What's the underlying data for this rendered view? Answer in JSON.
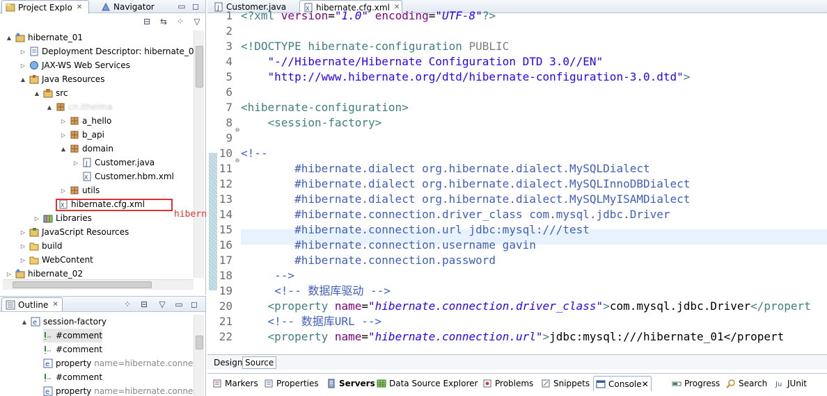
{
  "explorer": {
    "tabs": [
      {
        "label": "Project Explo",
        "icon": "project-explorer-icon"
      },
      {
        "label": "Navigator",
        "icon": "navigator-icon"
      }
    ],
    "items": [
      {
        "label": "hibernate_01",
        "icon": "project-icon",
        "twisty": "▲"
      },
      {
        "label": "Deployment Descriptor: hibernate_0",
        "icon": "descriptor-icon",
        "twisty": "▷"
      },
      {
        "label": "JAX-WS Web Services",
        "icon": "webservice-icon",
        "twisty": "▷"
      },
      {
        "label": "Java Resources",
        "icon": "java-resources-icon",
        "twisty": "▲"
      },
      {
        "label": "src",
        "icon": "source-folder-icon",
        "twisty": "▲"
      },
      {
        "label": "cn.itheima",
        "icon": "package-icon",
        "twisty": "▲"
      },
      {
        "label": "a_hello",
        "icon": "package-icon",
        "twisty": "▷"
      },
      {
        "label": "b_api",
        "icon": "package-icon",
        "twisty": "▷"
      },
      {
        "label": "domain",
        "icon": "package-icon",
        "twisty": "▲"
      },
      {
        "label": "Customer.java",
        "icon": "java-file-icon",
        "twisty": "▷"
      },
      {
        "label": "Customer.hbm.xml",
        "icon": "xml-file-icon",
        "twisty": ""
      },
      {
        "label": "utils",
        "icon": "package-icon",
        "twisty": "▷"
      },
      {
        "label": "hibernate.cfg.xml",
        "icon": "xml-file-icon",
        "twisty": ""
      },
      {
        "label": "Libraries",
        "icon": "libraries-icon",
        "twisty": "▷"
      },
      {
        "label": "JavaScript Resources",
        "icon": "js-resources-icon",
        "twisty": "▷"
      },
      {
        "label": "build",
        "icon": "folder-icon",
        "twisty": "▷"
      },
      {
        "label": "WebContent",
        "icon": "folder-icon",
        "twisty": "▷"
      },
      {
        "label": "hibernate_02",
        "icon": "project-icon",
        "twisty": "▷"
      }
    ]
  },
  "annotation": "hibernate在src根目录下",
  "outline": {
    "tab_label": "Outline",
    "items": [
      {
        "label": "session-factory",
        "attr": "",
        "icon": "element-icon"
      },
      {
        "label": "#comment",
        "attr": "",
        "icon": "comment-icon"
      },
      {
        "label": "#comment",
        "attr": "",
        "icon": "comment-icon"
      },
      {
        "label": "property",
        "attr": "name=hibernate.conne",
        "icon": "element-icon"
      },
      {
        "label": "#comment",
        "attr": "",
        "icon": "comment-icon"
      },
      {
        "label": "property",
        "attr": "name=hibernate.conne",
        "icon": "element-icon"
      }
    ]
  },
  "editor": {
    "tabs": [
      {
        "label": "Customer.java",
        "icon": "java-file-icon"
      },
      {
        "label": "hibernate.cfg.xml",
        "icon": "xml-file-icon"
      }
    ],
    "bottom_tabs": [
      "Design",
      "Source"
    ],
    "lines": [
      {
        "n": "1",
        "segs": [
          [
            "tagc",
            "<?xml "
          ],
          [
            "attr",
            "version"
          ],
          [
            "blk",
            "="
          ],
          [
            "val",
            "\"1.0\""
          ],
          [
            "blk",
            " "
          ],
          [
            "attr",
            "encoding"
          ],
          [
            "blk",
            "="
          ],
          [
            "val",
            "\"UTF-8\""
          ],
          [
            "tagc",
            "?>"
          ]
        ]
      },
      {
        "n": "2",
        "segs": []
      },
      {
        "n": "3",
        "segs": [
          [
            "tagc",
            "<!DOCTYPE "
          ],
          [
            "tagc",
            "hibernate-configuration "
          ],
          [
            "gray",
            "PUBLIC"
          ]
        ]
      },
      {
        "n": "4",
        "segs": [
          [
            "str",
            "    \"-//Hibernate/Hibernate Configuration DTD 3.0//EN\""
          ]
        ]
      },
      {
        "n": "5",
        "segs": [
          [
            "str",
            "    \"http://www.hibernate.org/dtd/hibernate-configuration-3.0.dtd\""
          ],
          [
            "tagc",
            ">"
          ]
        ]
      },
      {
        "n": "6",
        "segs": []
      },
      {
        "n": "7",
        "segs": [
          [
            "tagc",
            "<hibernate-configuration>"
          ]
        ]
      },
      {
        "n": "8",
        "segs": [
          [
            "tagc",
            "    <session-factory>"
          ]
        ]
      },
      {
        "n": "9",
        "segs": []
      },
      {
        "n": "10",
        "segs": [
          [
            "cmt",
            "<!--"
          ]
        ]
      },
      {
        "n": "11",
        "segs": [
          [
            "cmt",
            "        #hibernate.dialect org.hibernate.dialect.MySQLDialect"
          ]
        ]
      },
      {
        "n": "12",
        "segs": [
          [
            "cmt",
            "        #hibernate.dialect org.hibernate.dialect.MySQLInnoDBDialect"
          ]
        ]
      },
      {
        "n": "13",
        "segs": [
          [
            "cmt",
            "        #hibernate.dialect org.hibernate.dialect.MySQLMyISAMDialect"
          ]
        ]
      },
      {
        "n": "14",
        "segs": [
          [
            "cmt",
            "        #hibernate.connection.driver_class com.mysql.jdbc.Driver"
          ]
        ]
      },
      {
        "n": "15",
        "segs": [
          [
            "cmt",
            "        #hibernate.connection.url jdbc:mysql:///test"
          ]
        ]
      },
      {
        "n": "16",
        "segs": [
          [
            "cmt",
            "        #hibernate.connection.username gavin"
          ]
        ]
      },
      {
        "n": "17",
        "segs": [
          [
            "cmt",
            "        #hibernate.connection.password"
          ]
        ]
      },
      {
        "n": "18",
        "segs": [
          [
            "cmt",
            "     -->"
          ]
        ]
      },
      {
        "n": "19",
        "segs": [
          [
            "cmt",
            "     <!-- 数据库驱动 -->"
          ]
        ]
      },
      {
        "n": "20",
        "segs": [
          [
            "tagc",
            "    <property "
          ],
          [
            "attr",
            "name"
          ],
          [
            "blk",
            "="
          ],
          [
            "val",
            "\"hibernate.connection.driver_class\""
          ],
          [
            "tagc",
            ">"
          ],
          [
            "blk",
            "com.mysql.jdbc.Driver"
          ],
          [
            "tagc",
            "</propert"
          ]
        ]
      },
      {
        "n": "21",
        "segs": [
          [
            "cmt",
            "    <!-- 数据库URL -->"
          ]
        ]
      },
      {
        "n": "22",
        "segs": [
          [
            "tagc",
            "    <property "
          ],
          [
            "attr",
            "name"
          ],
          [
            "blk",
            "="
          ],
          [
            "val",
            "\"hibernate.connection.url\""
          ],
          [
            "tagc",
            ">"
          ],
          [
            "blk",
            "jdbc:mysql:///hibernate_01</propert"
          ]
        ]
      }
    ]
  },
  "views": {
    "tabs": [
      {
        "label": "Markers",
        "icon": "markers-icon"
      },
      {
        "label": "Properties",
        "icon": "properties-icon"
      },
      {
        "label": "Servers",
        "icon": "servers-icon"
      },
      {
        "label": "Data Source Explorer",
        "icon": "data-source-icon"
      },
      {
        "label": "Problems",
        "icon": "problems-icon"
      },
      {
        "label": "Snippets",
        "icon": "snippets-icon"
      },
      {
        "label": "Console",
        "icon": "console-icon"
      },
      {
        "label": "Progress",
        "icon": "progress-icon"
      },
      {
        "label": "Search",
        "icon": "search-icon"
      },
      {
        "label": "JUnit",
        "icon": "junit-icon"
      }
    ]
  }
}
